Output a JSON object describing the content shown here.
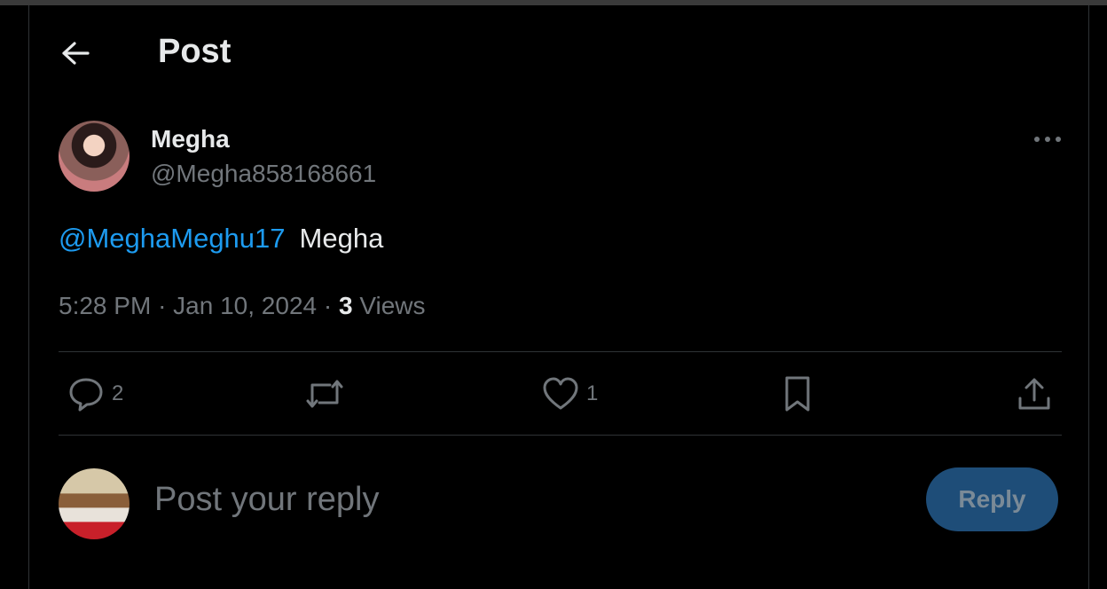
{
  "header": {
    "title": "Post"
  },
  "post": {
    "author_name": "Megha",
    "author_handle": "@Megha858168661",
    "mention": "@MeghaMeghu17",
    "text": "Megha",
    "time": "5:28 PM",
    "date": "Jan 10, 2024",
    "views_count": "3",
    "views_label": "Views"
  },
  "actions": {
    "reply_count": "2",
    "like_count": "1"
  },
  "reply": {
    "placeholder": "Post your reply",
    "button_label": "Reply"
  },
  "colors": {
    "background": "#000000",
    "text": "#e7e9ea",
    "muted": "#71767b",
    "accent": "#1d9bf0",
    "reply_button_disabled": "#1e4d78"
  },
  "icons": [
    "back-arrow-icon",
    "more-icon",
    "reply-icon",
    "repost-icon",
    "like-icon",
    "bookmark-icon",
    "share-icon"
  ]
}
